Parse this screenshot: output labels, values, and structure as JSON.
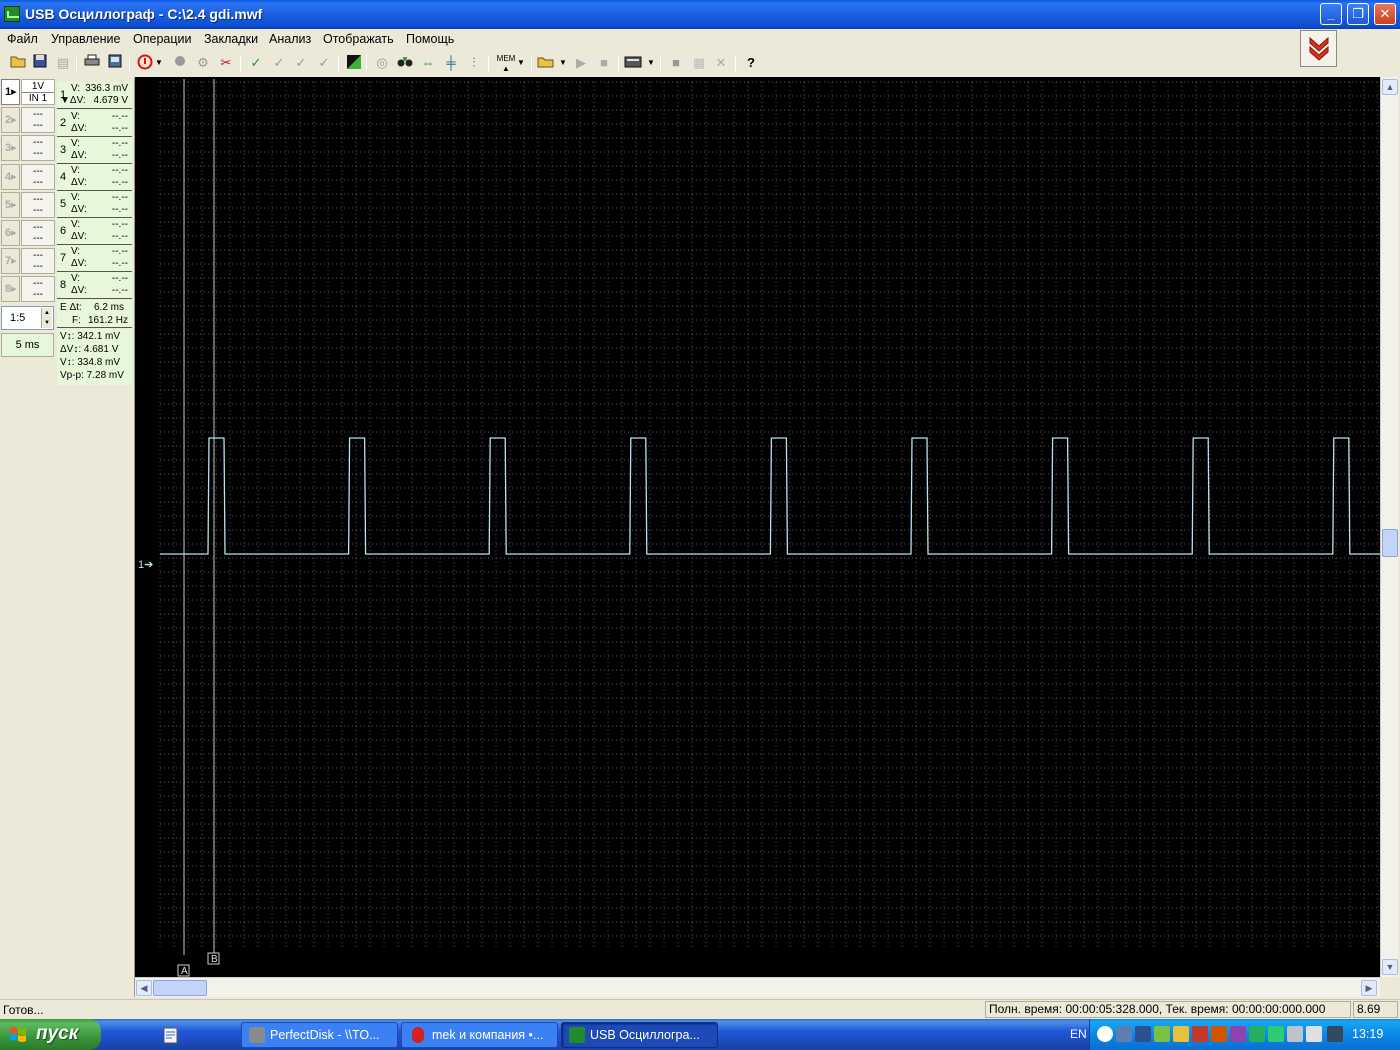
{
  "window": {
    "title": "USB Осциллограф - C:\\2.4 gdi.mwf",
    "minimize_label": "_",
    "maximize_label": "❐",
    "close_label": "✕"
  },
  "menu": [
    "Файл",
    "Управление",
    "Операции",
    "Закладки",
    "Анализ",
    "Отображать",
    "Помощь"
  ],
  "channels": [
    {
      "num": "1",
      "button": "1",
      "gain1": "1V",
      "gain2": "IN 1",
      "v_label": "V:",
      "v": "336.3 mV",
      "dv_label": "▼ΔV:",
      "dv": "4.679 V"
    },
    {
      "num": "2",
      "button": "2",
      "gain1": "---",
      "gain2": "---",
      "v_label": "V:",
      "v": "--.--",
      "dv_label": "ΔV:",
      "dv": "--.--"
    },
    {
      "num": "3",
      "button": "3",
      "gain1": "---",
      "gain2": "---",
      "v_label": "V:",
      "v": "--.--",
      "dv_label": "ΔV:",
      "dv": "--.--"
    },
    {
      "num": "4",
      "button": "4",
      "gain1": "---",
      "gain2": "---",
      "v_label": "V:",
      "v": "--.--",
      "dv_label": "ΔV:",
      "dv": "--.--"
    },
    {
      "num": "5",
      "button": "5",
      "gain1": "---",
      "gain2": "---",
      "v_label": "V:",
      "v": "--.--",
      "dv_label": "ΔV:",
      "dv": "--.--"
    },
    {
      "num": "6",
      "button": "6",
      "gain1": "---",
      "gain2": "---",
      "v_label": "V:",
      "v": "--.--",
      "dv_label": "ΔV:",
      "dv": "--.--"
    },
    {
      "num": "7",
      "button": "7",
      "gain1": "---",
      "gain2": "---",
      "v_label": "V:",
      "v": "--.--",
      "dv_label": "ΔV:",
      "dv": "--.--"
    },
    {
      "num": "8",
      "button": "8",
      "gain1": "---",
      "gain2": "---",
      "v_label": "V:",
      "v": "--.--",
      "dv_label": "ΔV:",
      "dv": "--.--"
    }
  ],
  "cursor_info": {
    "dt_label": "E Δt:",
    "dt": "6.2 ms",
    "f_label": "F:",
    "f": "161.2 Hz"
  },
  "measurements": [
    "V↕: 342.1 mV",
    "ΔV↕: 4.681 V",
    "V↕: 334.8 mV",
    "Vp-p: 7.28 mV"
  ],
  "zoom": "1:5",
  "time_div": "5 ms",
  "scope": {
    "channel_marker": "1",
    "cursor_a_label": "A",
    "cursor_b_label": "B",
    "trace_color": "#B4E4F0",
    "grid_color": "#5a5a5a",
    "pulse_period_ms": 6.2,
    "pulse_count_visible": 9,
    "high_level_v": 5.0,
    "low_level_v": 0.34
  },
  "status": {
    "left": "Готов...",
    "times": "Полн. время: 00:00:05:328.000, Тек. время: 00:00:00:000.000",
    "value": "8.69"
  },
  "taskbar": {
    "start": "пуск",
    "tasks": [
      {
        "label": "PerfectDisk - \\\\TO...",
        "color": "#8a8a8a"
      },
      {
        "label": "mek и компания •...",
        "color": "#d4201e"
      },
      {
        "label": "USB Осциллогра...",
        "color": "#1F8B2A"
      }
    ],
    "lang": "EN",
    "clock": "13:19"
  }
}
